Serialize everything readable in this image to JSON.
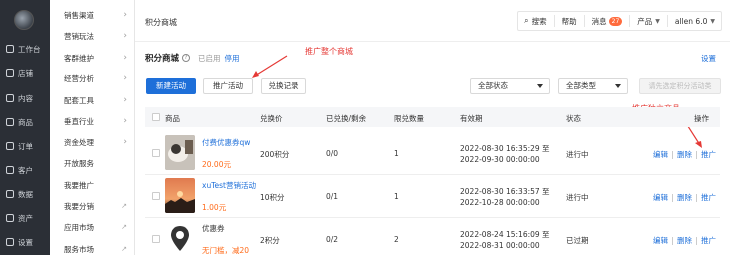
{
  "rail": {
    "items": [
      {
        "label": "工作台",
        "icon": "dashboard-icon"
      },
      {
        "label": "店铺",
        "icon": "shop-icon"
      },
      {
        "label": "内容",
        "icon": "content-icon"
      },
      {
        "label": "商品",
        "icon": "goods-icon"
      },
      {
        "label": "订单",
        "icon": "order-icon"
      },
      {
        "label": "客户",
        "icon": "customer-icon"
      },
      {
        "label": "数据",
        "icon": "data-icon"
      },
      {
        "label": "资产",
        "icon": "asset-icon"
      },
      {
        "label": "设置",
        "icon": "settings-icon"
      }
    ]
  },
  "menu2": {
    "items": [
      {
        "label": "销售渠道",
        "type": "chevron"
      },
      {
        "label": "营销玩法",
        "type": "chevron"
      },
      {
        "label": "客群维护",
        "type": "chevron"
      },
      {
        "label": "经营分析",
        "type": "chevron"
      },
      {
        "label": "配套工具",
        "type": "chevron"
      },
      {
        "label": "垂直行业",
        "type": "chevron"
      },
      {
        "label": "资金处理",
        "type": "chevron"
      },
      {
        "label": "开放服务",
        "type": "none"
      },
      {
        "label": "我要推广",
        "type": "none"
      },
      {
        "label": "我要分销",
        "type": "external"
      },
      {
        "label": "应用市场",
        "type": "external"
      },
      {
        "label": "服务市场",
        "type": "external"
      }
    ]
  },
  "header": {
    "page_title": "积分商城",
    "search": "搜索",
    "help": "帮助",
    "messages": "消息",
    "message_count": "27",
    "products": "产品",
    "user": "allen 6.0"
  },
  "main": {
    "title": "积分商城",
    "status": "已启用",
    "disable_link": "停用",
    "settings_link": "设置",
    "annotation_top": "推广整个商城",
    "annotation_right": "推广独立商品",
    "buttons": {
      "new": "新建活动",
      "promote": "推广活动",
      "records": "兑换记录",
      "select_first": "请先选定积分活动类"
    },
    "filters": {
      "status": "全部状态",
      "type": "全部类型"
    }
  },
  "table": {
    "headers": [
      "商品",
      "兑换价",
      "已兑换/剩余",
      "限兑数量",
      "有效期",
      "状态",
      "操作"
    ],
    "op_labels": [
      "编辑",
      "删除",
      "推广"
    ],
    "rows": [
      {
        "name": "付费优惠券qw",
        "price": "20.00元",
        "points": "200积分",
        "exchanged": "0/0",
        "limit": "1",
        "valid_from": "2022-08-30 16:35:29 至",
        "valid_to": "2022-09-30 00:00:00",
        "status": "进行中",
        "thumb": "cat"
      },
      {
        "name": "xuTest营销活动",
        "price": "1.00元",
        "points": "10积分",
        "exchanged": "0/1",
        "limit": "1",
        "valid_from": "2022-08-30 16:33:57 至",
        "valid_to": "2022-10-28 00:00:00",
        "status": "进行中",
        "thumb": "sunset"
      },
      {
        "name": "优惠券",
        "price": "无门槛，减20",
        "points": "2积分",
        "exchanged": "0/2",
        "limit": "2",
        "valid_from": "2022-08-24 15:16:09 至",
        "valid_to": "2022-08-31 00:00:00",
        "status": "已过期",
        "thumb": "pin"
      }
    ]
  },
  "colors": {
    "accent": "#1e6fd9",
    "annotation": "#e53935",
    "price": "#ff6b1a",
    "rail_bg": "#2b2f36"
  }
}
